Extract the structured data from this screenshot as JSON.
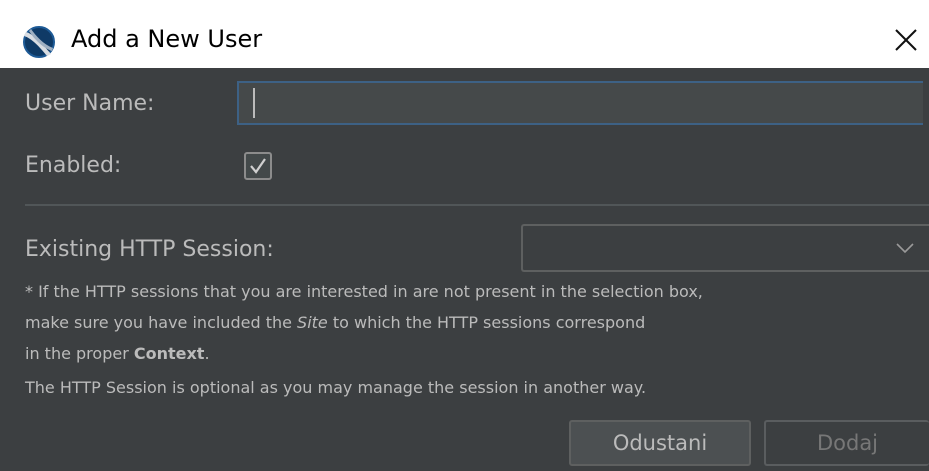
{
  "window": {
    "title": "Add a New User",
    "app_icon": "zap-logo-icon",
    "close_icon": "close-icon"
  },
  "form": {
    "username_label": "User Name:",
    "username_value": "",
    "enabled_label": "Enabled:",
    "enabled_checked": true,
    "session_label": "Existing HTTP Session:",
    "session_selected": "",
    "note": {
      "line1": "* If the HTTP sessions that you are interested in are not present in the selection box,",
      "line2_pre": "make sure you have included the ",
      "line2_site": "Site",
      "line2_post": " to which the HTTP sessions correspond",
      "line3_pre": "in the proper ",
      "line3_context": "Context",
      "line3_post": ".",
      "line4": "The HTTP Session is optional as you may manage the session in another way."
    }
  },
  "buttons": {
    "cancel": "Odustani",
    "add": "Dodaj",
    "add_enabled": false
  },
  "colors": {
    "background": "#3c3f41",
    "text": "#bbbbbb",
    "input_focus_border": "#3d6185",
    "disabled_text": "#777777"
  }
}
